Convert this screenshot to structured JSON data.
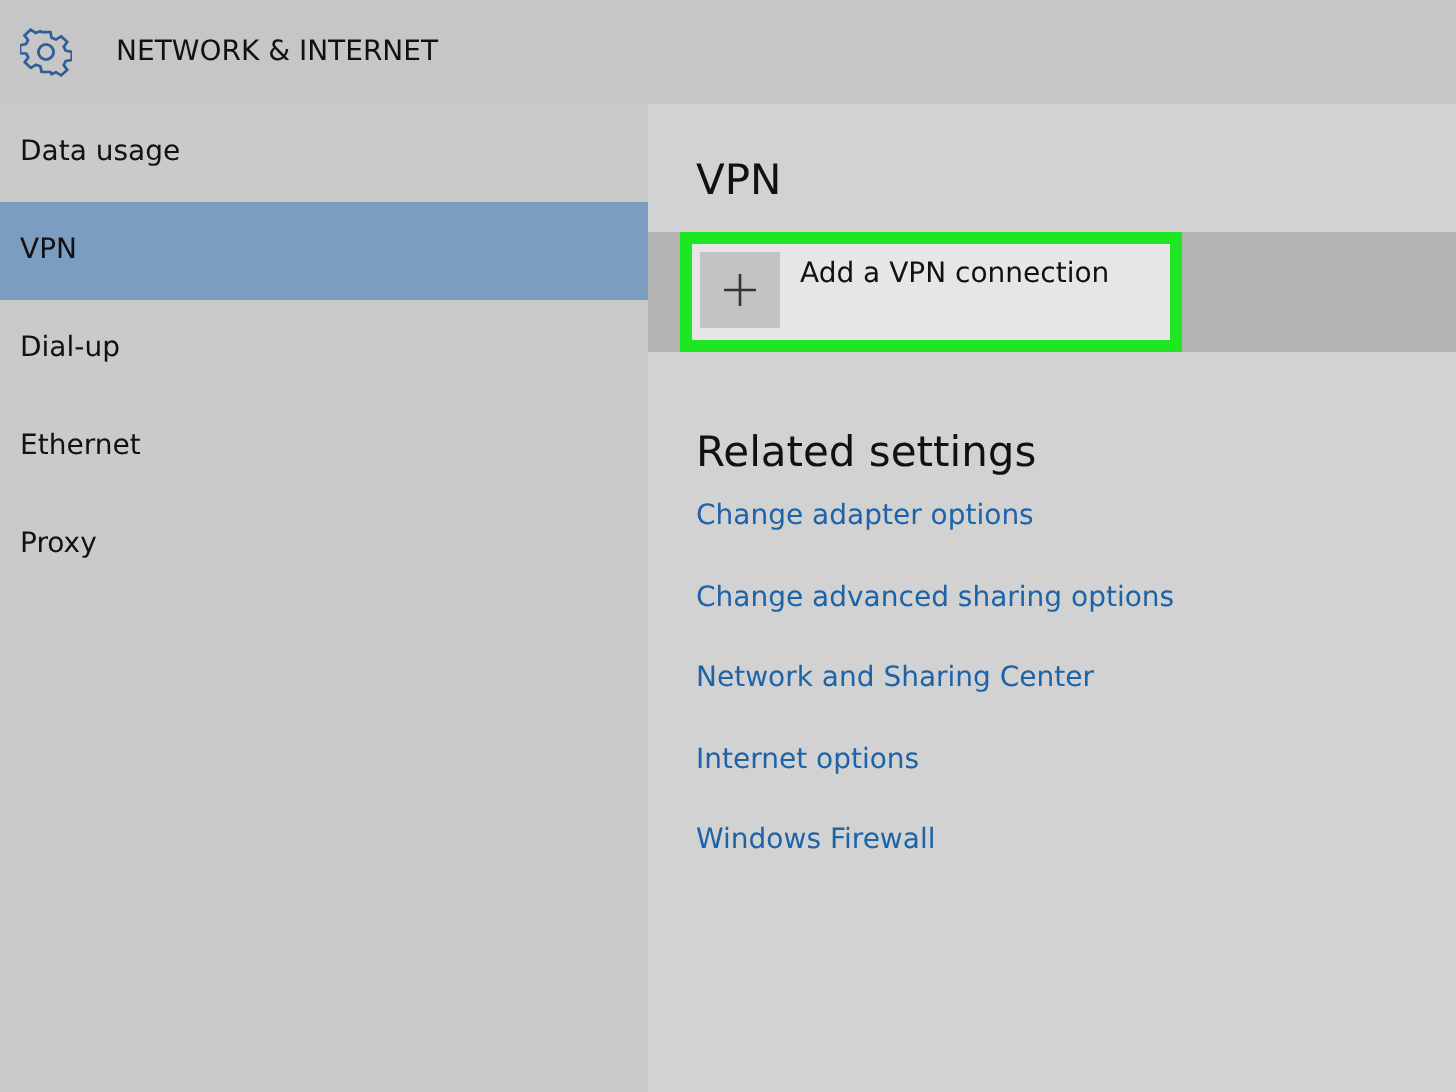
{
  "header": {
    "title": "NETWORK & INTERNET"
  },
  "sidebar": {
    "items": [
      {
        "label": "Data usage",
        "selected": false
      },
      {
        "label": "VPN",
        "selected": true
      },
      {
        "label": "Dial-up",
        "selected": false
      },
      {
        "label": "Ethernet",
        "selected": false
      },
      {
        "label": "Proxy",
        "selected": false
      }
    ]
  },
  "content": {
    "heading": "VPN",
    "add_button": {
      "label": "Add a VPN connection",
      "highlighted": true
    },
    "related_heading": "Related settings",
    "links": [
      "Change adapter options",
      "Change advanced sharing options",
      "Network and Sharing Center",
      "Internet options",
      "Windows Firewall"
    ]
  }
}
